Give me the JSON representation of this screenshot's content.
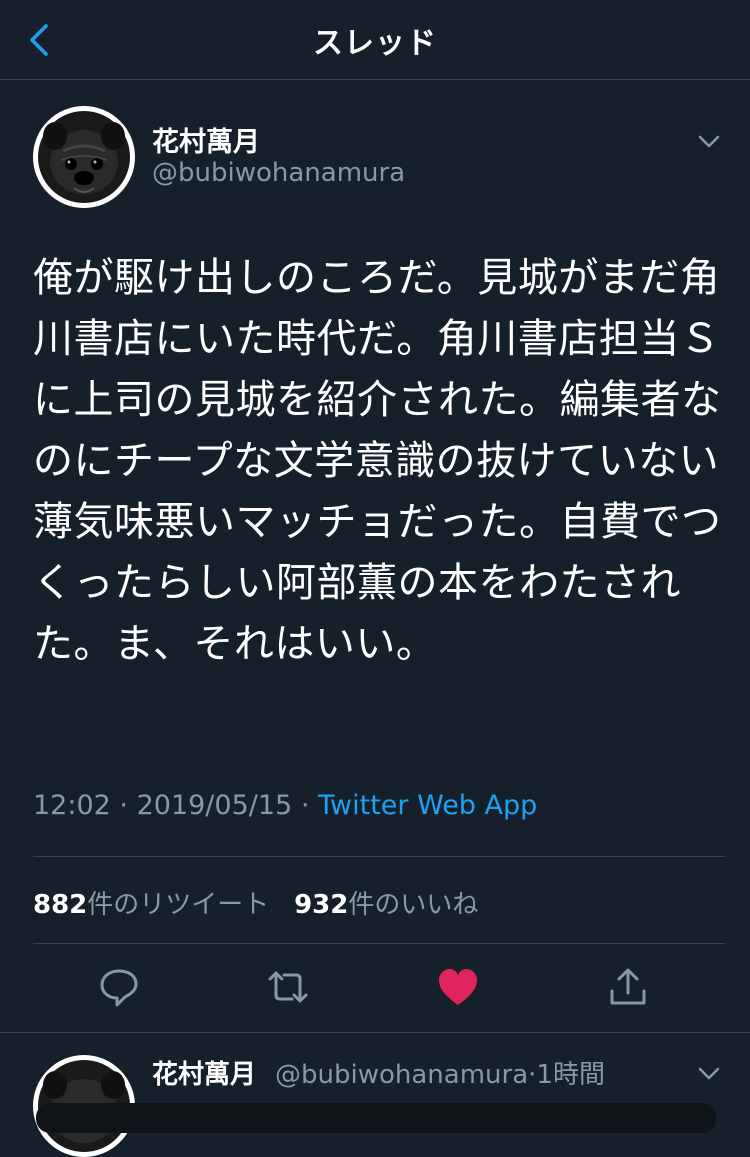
{
  "header": {
    "title": "スレッド",
    "back_icon": "chevron-left-icon"
  },
  "tweet": {
    "author_name": "花村萬月",
    "author_handle": "@bubiwohanamura",
    "text": "俺が駆け出しのころだ。見城がまだ角川書店にいた時代だ。角川書店担当Ｓに上司の見城を紹介された。編集者なのにチープな文学意識の抜けていない薄気味悪いマッチョだった。自費でつくったらしい阿部薫の本をわたされた。ま、それはいい。",
    "time": "12:02",
    "date": "2019/05/15",
    "separator": "·",
    "source": "Twitter Web App",
    "retweets_count": "882",
    "retweets_label": "件のリツイート",
    "likes_count": "932",
    "likes_label": "件のいいね"
  },
  "actions": [
    {
      "name": "reply",
      "icon": "reply-icon"
    },
    {
      "name": "retweet",
      "icon": "retweet-icon"
    },
    {
      "name": "like",
      "icon": "heart-icon",
      "active": true
    },
    {
      "name": "share",
      "icon": "share-icon"
    }
  ],
  "reply": {
    "author_name": "花村萬月",
    "author_handle": "@bubiwohanamura",
    "separator": "·",
    "time_ago": "1時間"
  },
  "colors": {
    "background": "#15202b",
    "divider": "#38444d",
    "secondary_text": "#8899a6",
    "accent": "#1da1f2",
    "like": "#e0245e"
  }
}
